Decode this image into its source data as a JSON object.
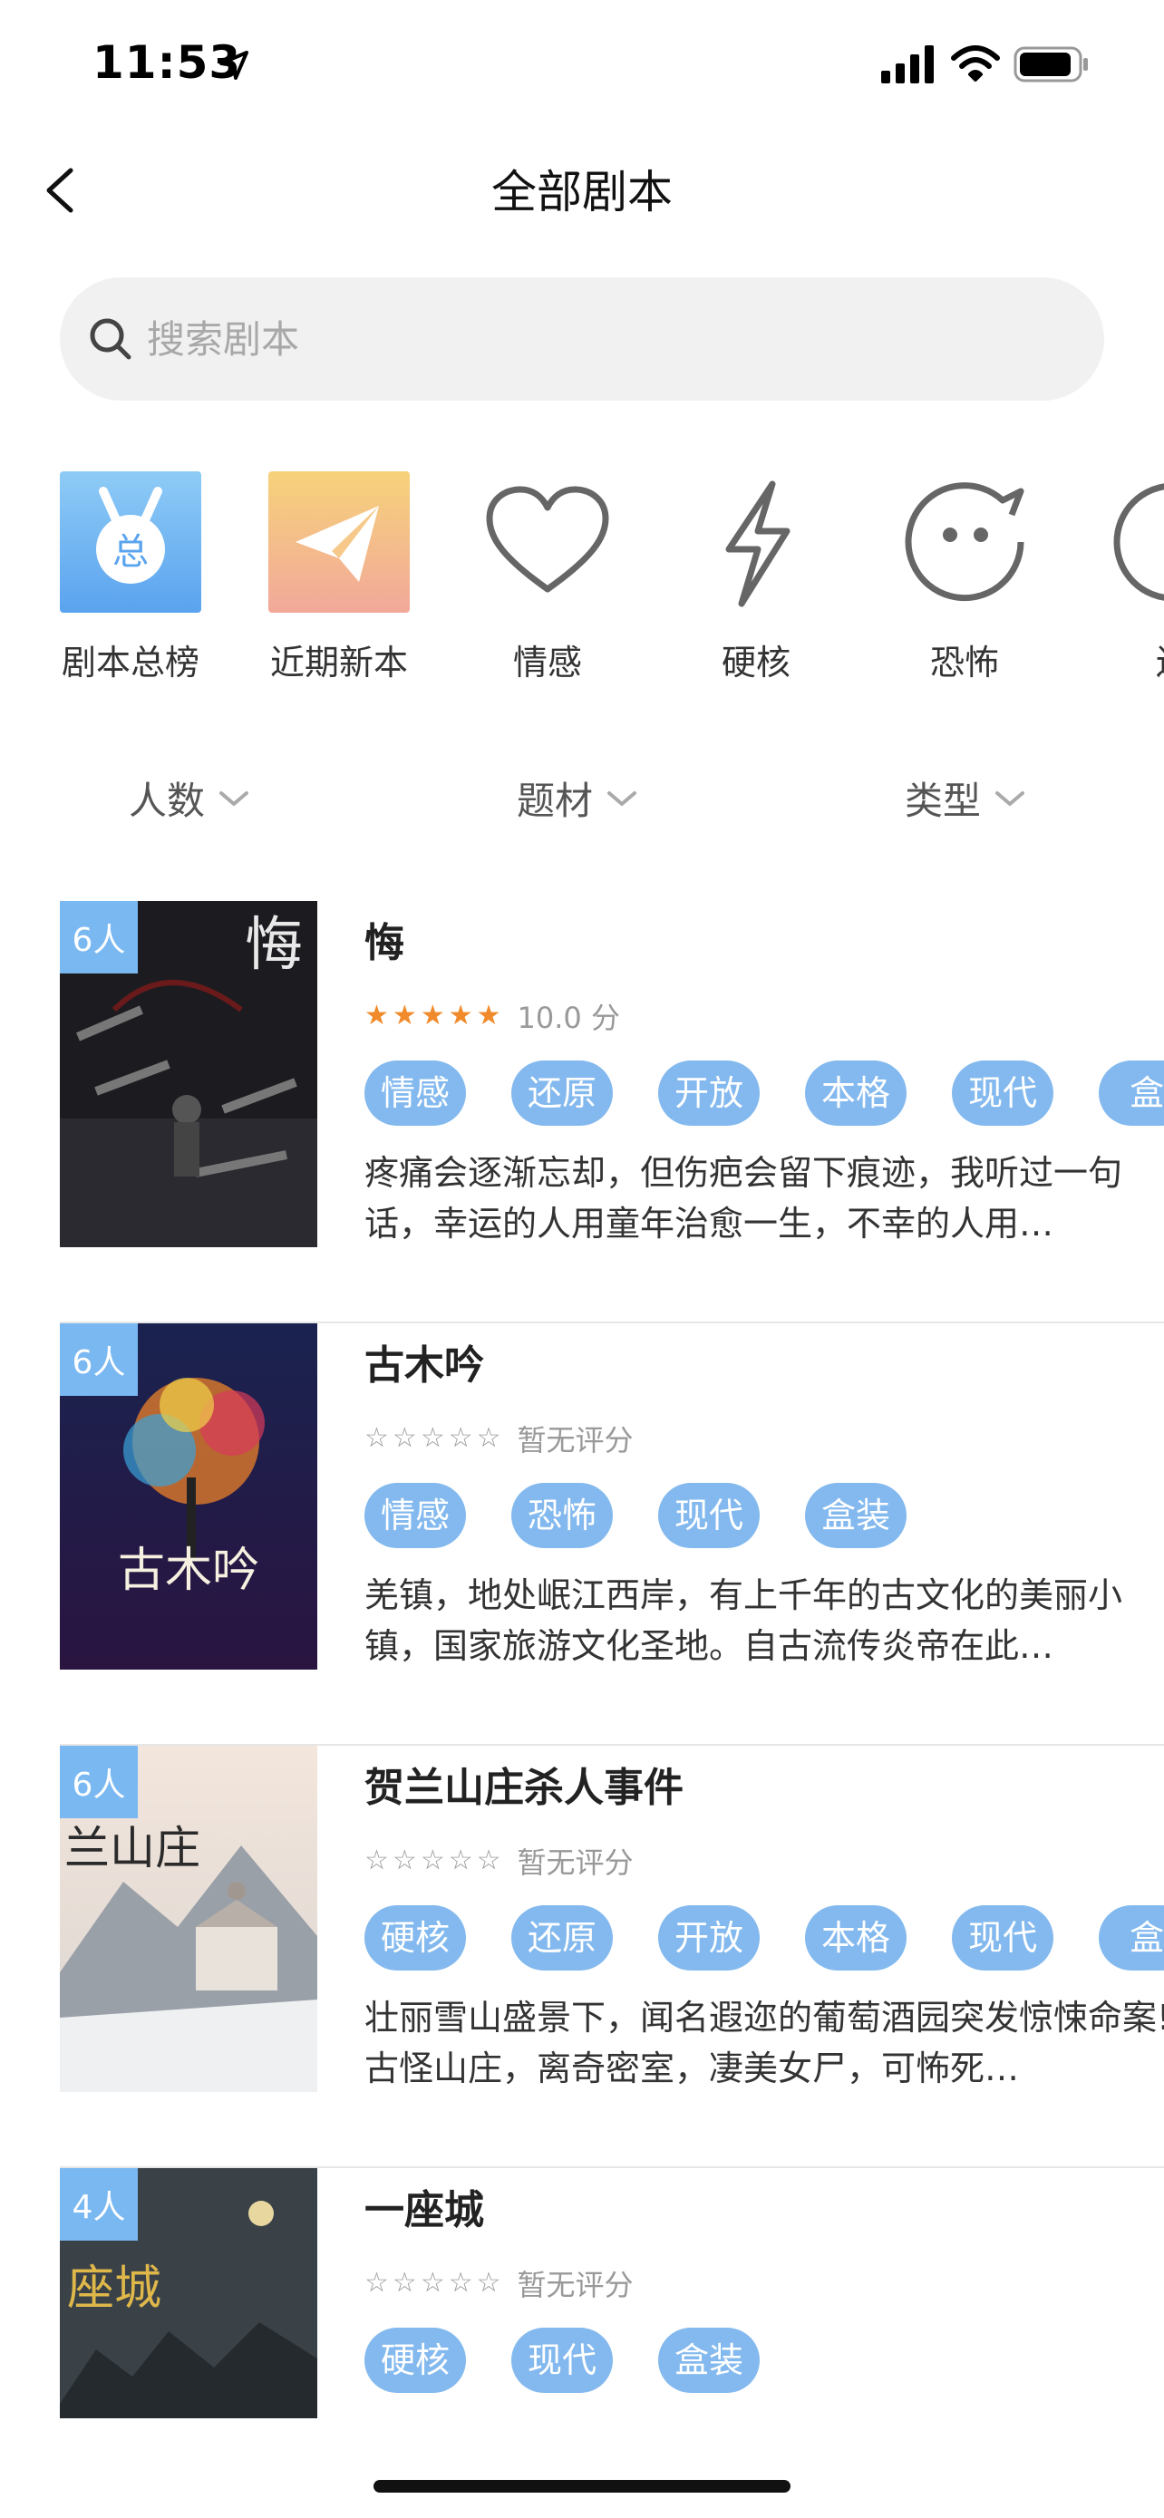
{
  "status_bar": {
    "time": "11:53"
  },
  "header": {
    "title": "全部剧本"
  },
  "search": {
    "placeholder": "搜索剧本"
  },
  "categories": [
    {
      "label": "剧本总榜",
      "icon": "ranking-medal-icon"
    },
    {
      "label": "近期新本",
      "icon": "paper-plane-icon"
    },
    {
      "label": "情感",
      "icon": "heart-icon"
    },
    {
      "label": "硬核",
      "icon": "lightning-icon"
    },
    {
      "label": "恐怖",
      "icon": "ghost-face-icon"
    },
    {
      "label": "还",
      "icon": "circle-icon"
    }
  ],
  "filters": [
    {
      "label": "人数"
    },
    {
      "label": "题材"
    },
    {
      "label": "类型"
    }
  ],
  "scripts": [
    {
      "players": "6人",
      "title": "悔",
      "rating_value": 5,
      "rating_text": "10.0 分",
      "tags": [
        "情感",
        "还原",
        "开放",
        "本格",
        "现代",
        "盒"
      ],
      "description": "疼痛会逐渐忘却，但伤疤会留下痕迹，我听过一句话，幸运的人用童年治愈一生，不幸的人用…",
      "cover_text": "悔"
    },
    {
      "players": "6人",
      "title": "古木吟",
      "rating_value": 0,
      "rating_text": "暂无评分",
      "tags": [
        "情感",
        "恐怖",
        "现代",
        "盒装"
      ],
      "description": "羌镇，地处岷江西岸，有上千年的古文化的美丽小镇，国家旅游文化圣地。自古流传炎帝在此…",
      "cover_text": "古木吟"
    },
    {
      "players": "6人",
      "title": "贺兰山庄杀人事件",
      "rating_value": 0,
      "rating_text": "暂无评分",
      "tags": [
        "硬核",
        "还原",
        "开放",
        "本格",
        "现代",
        "盒"
      ],
      "description": "壮丽雪山盛景下，闻名遐迩的葡萄酒园突发惊悚命案!古怪山庄，离奇密室，凄美女尸，可怖死…",
      "cover_text": "兰山庄"
    },
    {
      "players": "4人",
      "title": "一座城",
      "rating_value": 0,
      "rating_text": "暂无评分",
      "tags": [
        "硬核",
        "现代",
        "盒装"
      ],
      "description": "",
      "cover_text": "座城"
    }
  ],
  "colors": {
    "tag_bg": "#83b9ee",
    "badge_bg": "#7ab8f2",
    "star_full": "#f08a2a",
    "search_bg": "#f1f1f1"
  }
}
